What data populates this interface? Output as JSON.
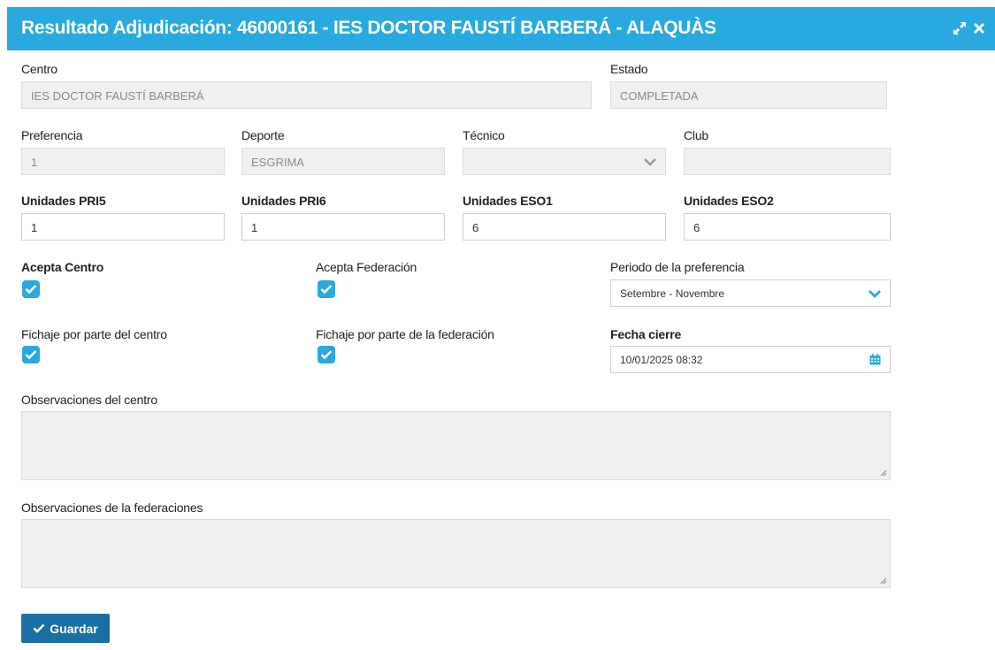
{
  "window": {
    "title": "Resultado Adjudicación: 46000161 - IES DOCTOR FAUSTÍ BARBERÁ - ALAQUÀS"
  },
  "fields": {
    "centro": {
      "label": "Centro",
      "value": "IES DOCTOR FAUSTÍ BARBERÁ"
    },
    "estado": {
      "label": "Estado",
      "value": "COMPLETADA"
    },
    "preferencia": {
      "label": "Preferencia",
      "value": "1"
    },
    "deporte": {
      "label": "Deporte",
      "value": "ESGRIMA"
    },
    "tecnico": {
      "label": "Técnico",
      "value": ""
    },
    "club": {
      "label": "Club",
      "value": ""
    },
    "unidades_pri5": {
      "label": "Unidades PRI5",
      "value": "1"
    },
    "unidades_pri6": {
      "label": "Unidades PRI6",
      "value": "1"
    },
    "unidades_eso1": {
      "label": "Unidades ESO1",
      "value": "6"
    },
    "unidades_eso2": {
      "label": "Unidades ESO2",
      "value": "6"
    },
    "acepta_centro": {
      "label": "Acepta Centro",
      "checked": true
    },
    "acepta_federacion": {
      "label": "Acepta Federación",
      "checked": true
    },
    "periodo": {
      "label": "Periodo de la preferencia",
      "value": "Setembre - Novembre"
    },
    "fichaje_centro": {
      "label": "Fichaje por parte del centro",
      "checked": true
    },
    "fichaje_federacion": {
      "label": "Fichaje por parte de la federación",
      "checked": true
    },
    "fecha_cierre": {
      "label": "Fecha cierre",
      "value": "10/01/2025 08:32"
    },
    "obs_centro": {
      "label": "Observaciones del centro",
      "value": ""
    },
    "obs_federaciones": {
      "label": "Observaciones de la federaciones",
      "value": ""
    }
  },
  "actions": {
    "save_label": "Guardar"
  },
  "colors": {
    "header": "#29a9e0",
    "checkbox": "#29a9e0",
    "button": "#1a6fa3"
  },
  "icons": [
    "expand-icon",
    "close-icon",
    "chevron-down-icon",
    "calendar-icon",
    "check-icon"
  ]
}
